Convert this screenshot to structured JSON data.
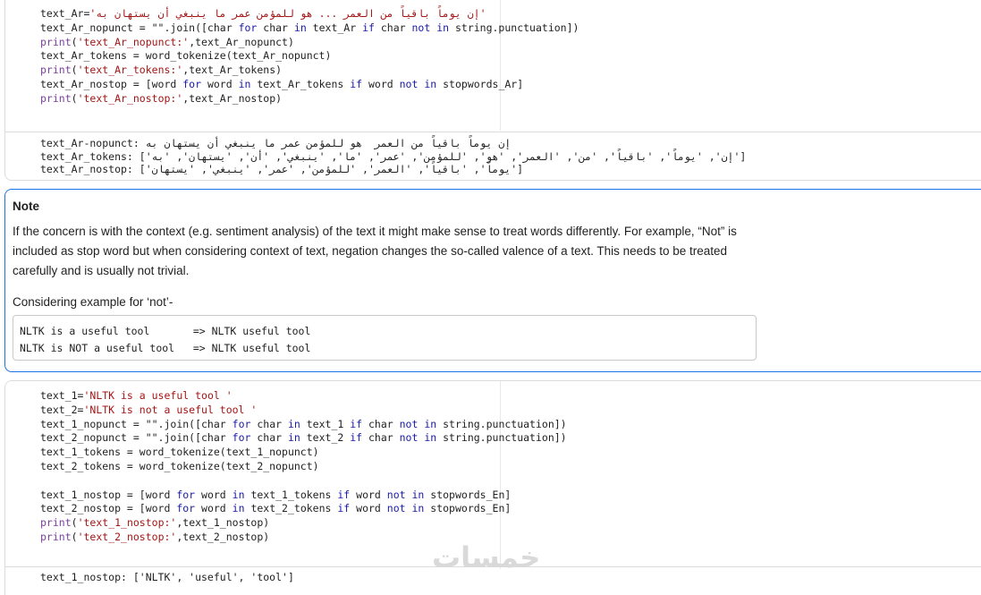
{
  "cell_top": {
    "code": {
      "l1_pre": "text_Ar=",
      "l1_str": "'إن يوماً باقياً من العمر ... هو للمؤمن عمر ما ينبغي أن يستهان به'",
      "l2_a": "text_Ar_nopunct = \"\".join([char ",
      "l2_for": "for",
      "l2_b": " char ",
      "l2_in": "in",
      "l2_c": " text_Ar ",
      "l2_if": "if",
      "l2_d": " char ",
      "l2_not": "not",
      "l2_in2": "in",
      "l2_e": " string.punctuation])",
      "l3_fn": "print",
      "l3_str": "'text_Ar_nopunct:'",
      "l3_rest": ",text_Ar_nopunct)",
      "l4": "text_Ar_tokens = word_tokenize(text_Ar_nopunct)",
      "l5_fn": "print",
      "l5_str": "'text_Ar_tokens:'",
      "l5_rest": ",text_Ar_tokens)",
      "l6_a": "text_Ar_nostop = [word ",
      "l6_for": "for",
      "l6_b": " word ",
      "l6_in": "in",
      "l6_c": " text_Ar_tokens ",
      "l6_if": "if",
      "l6_d": " word ",
      "l6_not": "not",
      "l6_in2": "in",
      "l6_e": " stopwords_Ar]",
      "l7_fn": "print",
      "l7_str": "'text_Ar_nostop:'",
      "l7_rest": ",text_Ar_nostop)"
    },
    "output": {
      "o1_label": "text_Ar-nopunct: ",
      "o1_value": "إن يوماً باقياً من العمر  هو للمؤمن عمر ما ينبغي أن يستهان به",
      "o2_label": "text_Ar_tokens: ",
      "o2_value": "['إن', 'يوماً', 'باقياً', 'من', 'العمر', 'هو', 'للمؤمن', 'عمر', 'ما', 'ينبغي', 'أن', 'يستهان', 'به']",
      "o3_label": "text_Ar_nostop: ",
      "o3_value": "['يوماً', 'باقياً', 'العمر', 'للمؤمن', 'عمر', 'ينبغي', 'يستهان']"
    }
  },
  "note": {
    "title": "Note",
    "body": "If the concern is with the context (e.g. sentiment analysis) of the text it might make sense to treat words differently. For example, “Not” is included as stop word but when considering context of text, negation changes the so-called valence of a text. This needs to be treated carefully and is usually not trivial.",
    "example_label": "Considering example for ‘not’-",
    "example_line1": "NLTK is a useful tool       => NLTK useful tool",
    "example_line2": "NLTK is NOT a useful tool   => NLTK useful tool"
  },
  "cell_bottom": {
    "code": {
      "b1_pre": "text_1=",
      "b1_str": "'NLTK is a useful tool '",
      "b2_pre": "text_2=",
      "b2_str": "'NLTK is not a useful tool '",
      "b3_a": "text_1_nopunct = \"\".join([char ",
      "b3_for": "for",
      "b3_b": " char ",
      "b3_in": "in",
      "b3_c": " text_1 ",
      "b3_if": "if",
      "b3_d": " char ",
      "b3_not": "not",
      "b3_in2": "in",
      "b3_e": " string.punctuation])",
      "b4_a": "text_2_nopunct = \"\".join([char ",
      "b4_for": "for",
      "b4_b": " char ",
      "b4_in": "in",
      "b4_c": " text_2 ",
      "b4_if": "if",
      "b4_d": " char ",
      "b4_not": "not",
      "b4_in2": "in",
      "b4_e": " string.punctuation])",
      "b5": "text_1_tokens = word_tokenize(text_1_nopunct)",
      "b6": "text_2_tokens = word_tokenize(text_2_nopunct)",
      "b8_a": "text_1_nostop = [word ",
      "b8_for": "for",
      "b8_b": " word ",
      "b8_in": "in",
      "b8_c": " text_1_tokens ",
      "b8_if": "if",
      "b8_d": " word ",
      "b8_not": "not",
      "b8_in2": "in",
      "b8_e": " stopwords_En]",
      "b9_a": "text_2_nostop = [word ",
      "b9_for": "for",
      "b9_b": " word ",
      "b9_in": "in",
      "b9_c": " text_2_tokens ",
      "b9_if": "if",
      "b9_d": " word ",
      "b9_not": "not",
      "b9_in2": "in",
      "b9_e": " stopwords_En]",
      "b10_fn": "print",
      "b10_str": "'text_1_nostop:'",
      "b10_rest": ",text_1_nostop)",
      "b11_fn": "print",
      "b11_str": "'text_2_nostop:'",
      "b11_rest": ",text_2_nostop)"
    },
    "output": {
      "o1": "text_1_nostop: ['NLTK', 'useful', 'tool']"
    }
  },
  "watermark": "خمسات"
}
